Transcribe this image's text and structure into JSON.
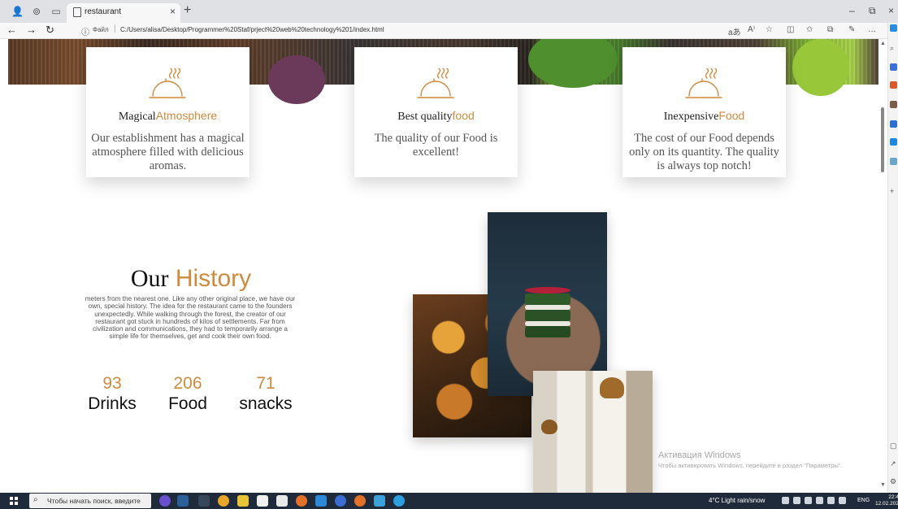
{
  "browser": {
    "tab_title": "restaurant",
    "tab_close": "×",
    "new_tab": "+",
    "protocol_label": "Файл",
    "url": "C:/Users/alisa/Desktop/Programmer%20Staf/prject%20web%20technology%201/index.html",
    "window_min": "–",
    "window_restore": "⧉",
    "window_close": "×"
  },
  "features": [
    {
      "title_plain": "Magical",
      "title_accent": "Atmosphere",
      "description": "Our establishment has a magical atmosphere filled with delicious aromas."
    },
    {
      "title_plain": "Best quality",
      "title_accent": "food",
      "description": "The quality of our Food is excellent!"
    },
    {
      "title_plain": "Inexpensive",
      "title_accent": "Food",
      "description": "The cost of our Food depends only on its quantity. The quality is always top notch!"
    }
  ],
  "history": {
    "title_plain": "Our",
    "title_accent": "History",
    "text": "meters from the nearest one. Like any other original place, we have our own, special history. The idea for the restaurant came to the founders unexpectedly. While walking through the forest, the creator of our restaurant got stuck in hundreds of kilos of settlements. Far from civilization and communications, they had to temporarily arrange a simple life for themselves, get and cook their own food."
  },
  "stats": [
    {
      "number": "93",
      "label": "Drinks"
    },
    {
      "number": "206",
      "label": "Food"
    },
    {
      "number": "71",
      "label": "snacks"
    }
  ],
  "watermark": {
    "line1": "Активация Windows",
    "line2": "Чтобы активировать Windows, перейдите в раздел \"Параметры\"."
  },
  "taskbar": {
    "search_placeholder": "Чтобы начать поиск, введите",
    "weather": "4°C  Light rain/snow",
    "language": "ENG",
    "time": "22:48",
    "date": "12.02.2023"
  },
  "colors": {
    "accent": "#d08a3d",
    "taskbar": "#1f2b3a",
    "chrome": "#dfe1e5"
  }
}
